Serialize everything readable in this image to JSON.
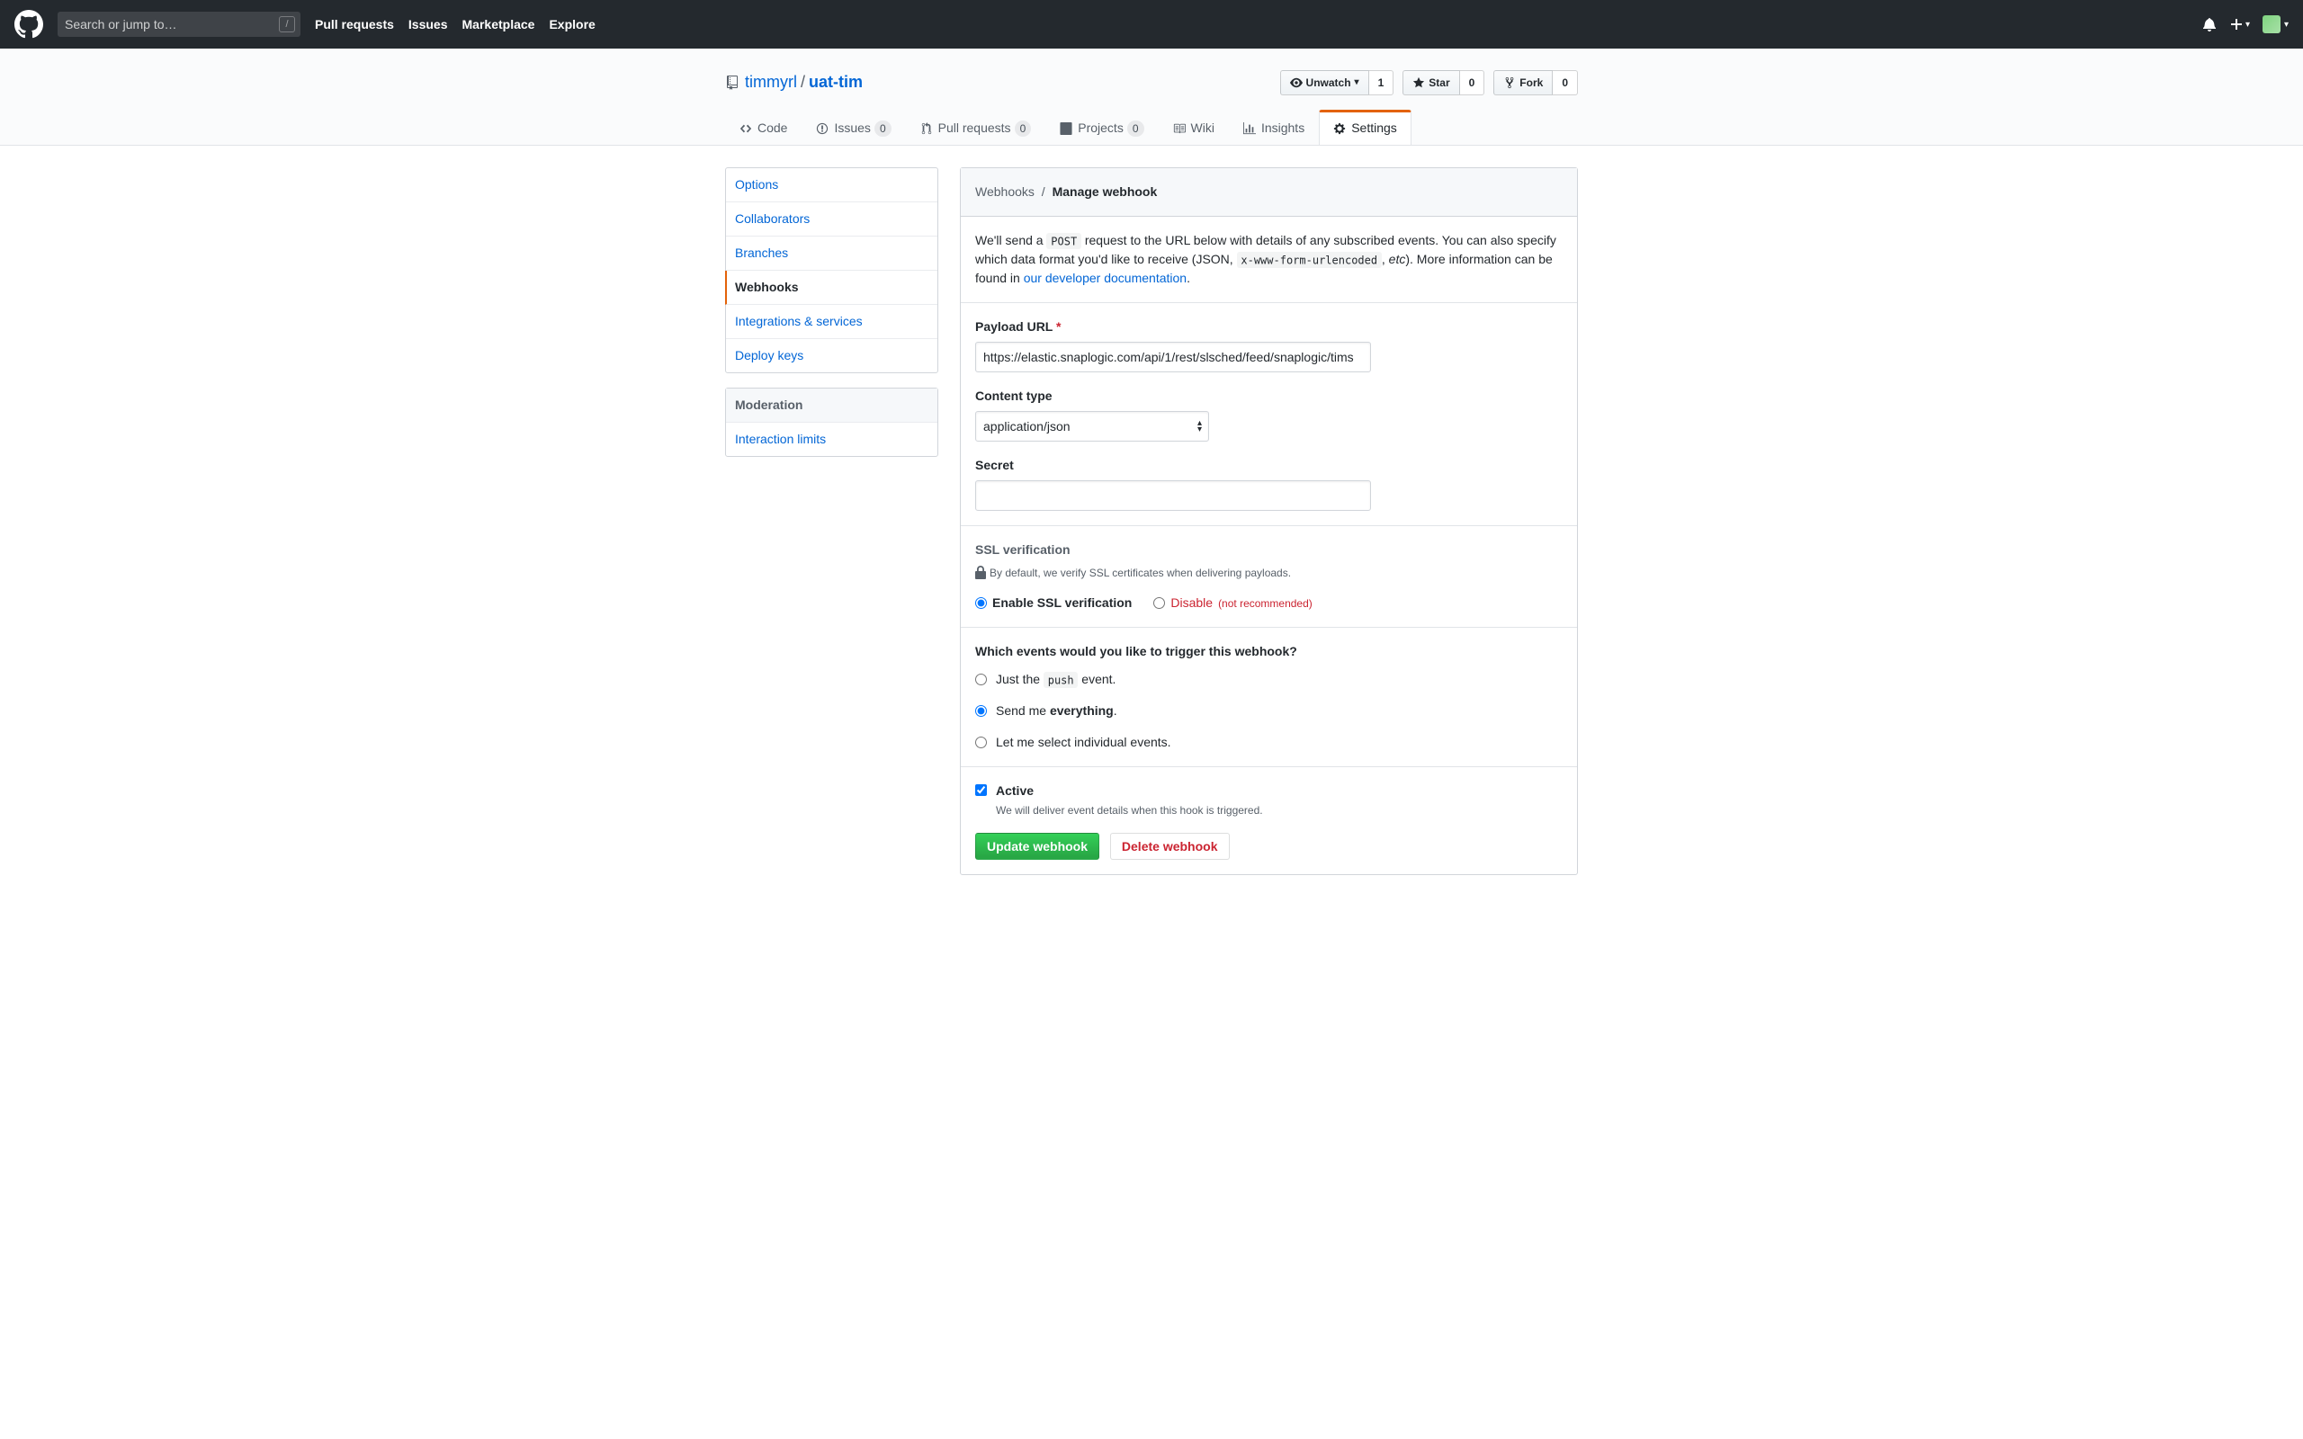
{
  "header": {
    "search_placeholder": "Search or jump to…",
    "slash": "/",
    "nav": [
      "Pull requests",
      "Issues",
      "Marketplace",
      "Explore"
    ]
  },
  "repo": {
    "owner": "timmyrl",
    "name": "uat-tim",
    "actions": {
      "unwatch": "Unwatch",
      "watch_count": "1",
      "star": "Star",
      "star_count": "0",
      "fork": "Fork",
      "fork_count": "0"
    }
  },
  "tabs": {
    "code": "Code",
    "issues": "Issues",
    "issues_count": "0",
    "prs": "Pull requests",
    "prs_count": "0",
    "projects": "Projects",
    "projects_count": "0",
    "wiki": "Wiki",
    "insights": "Insights",
    "settings": "Settings"
  },
  "sidebar": {
    "items": [
      "Options",
      "Collaborators",
      "Branches",
      "Webhooks",
      "Integrations & services",
      "Deploy keys"
    ],
    "moderation": "Moderation",
    "mod_items": [
      "Interaction limits"
    ]
  },
  "breadcrumb": {
    "prefix": "Webhooks",
    "sep": "/",
    "current": "Manage webhook"
  },
  "intro": {
    "p1a": "We'll send a ",
    "post": "POST",
    "p1b": " request to the URL below with details of any subscribed events. You can also specify which data format you'd like to receive (JSON, ",
    "urlencoded": "x-www-form-urlencoded",
    "p1c": ", ",
    "etc": "etc",
    "p1d": "). More information can be found in ",
    "link": "our developer documentation",
    "p1e": "."
  },
  "form": {
    "payload_label": "Payload URL",
    "payload_value": "https://elastic.snaplogic.com/api/1/rest/slsched/feed/snaplogic/tims",
    "content_type_label": "Content type",
    "content_type_value": "application/json",
    "secret_label": "Secret"
  },
  "ssl": {
    "heading": "SSL verification",
    "note": "By default, we verify SSL certificates when delivering payloads.",
    "enable": "Enable SSL verification",
    "disable": "Disable",
    "disable_note": "(not recommended)"
  },
  "events": {
    "heading": "Which events would you like to trigger this webhook?",
    "push_a": "Just the ",
    "push_code": "push",
    "push_b": " event.",
    "everything_a": "Send me ",
    "everything_b": "everything",
    "everything_c": ".",
    "individual": "Let me select individual events."
  },
  "active": {
    "label": "Active",
    "desc": "We will deliver event details when this hook is triggered."
  },
  "buttons": {
    "update": "Update webhook",
    "delete": "Delete webhook"
  }
}
